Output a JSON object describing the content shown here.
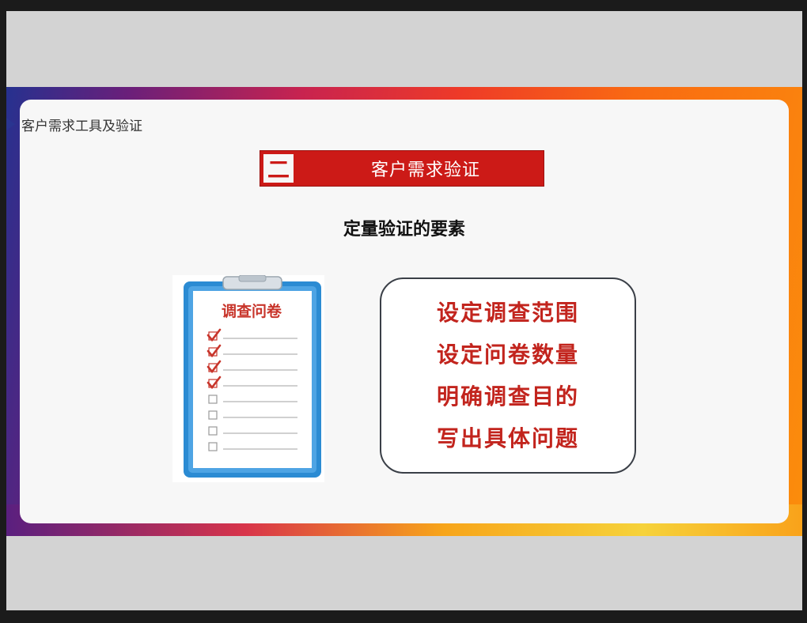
{
  "breadcrumb": {
    "text": "客户需求工具及验证"
  },
  "section": {
    "number": "二",
    "title": "客户需求验证"
  },
  "subtitle": "定量验证的要素",
  "clipboard": {
    "title": "调查问卷",
    "items": [
      {
        "checked": true
      },
      {
        "checked": true
      },
      {
        "checked": true
      },
      {
        "checked": true
      },
      {
        "checked": false
      },
      {
        "checked": false
      },
      {
        "checked": false
      },
      {
        "checked": false
      }
    ]
  },
  "points": [
    "设定调查范围",
    "设定问卷数量",
    "明确调查目的",
    "写出具体问题"
  ],
  "colors": {
    "accent_red": "#cc1a17",
    "point_text": "#c2241d",
    "clipboard_blue": "#2b8bd3",
    "check_red": "#c8352b"
  }
}
